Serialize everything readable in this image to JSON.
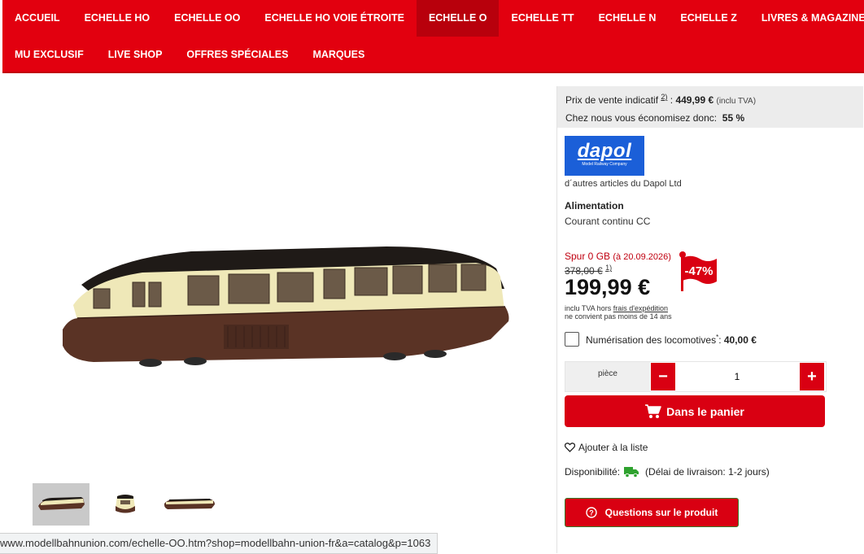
{
  "nav": {
    "row1": [
      "ACCUEIL",
      "ECHELLE HO",
      "ECHELLE OO",
      "ECHELLE HO VOIE ÉTROITE",
      "ECHELLE O",
      "ECHELLE TT",
      "ECHELLE N",
      "ECHELLE Z",
      "LIVRES & MAGAZINES"
    ],
    "row2": [
      "MU EXCLUSIF",
      "LIVE SHOP",
      "OFFRES SPÉCIALES",
      "MARQUES"
    ],
    "active": "ECHELLE O"
  },
  "price_info": {
    "rrp_label": "Prix de vente indicatif",
    "rrp_ref": "2)",
    "rrp_value": "449,99 €",
    "rrp_note": "(inclu TVA)",
    "saving_label": "Chez nous vous économisez donc:",
    "saving_value": "55 %"
  },
  "brand": {
    "logo_text": "dapol",
    "logo_subtext": "Model Railway Company",
    "more_link": "d´autres articles du Dapol Ltd"
  },
  "power": {
    "label": "Alimentation",
    "value": "Courant continu CC"
  },
  "offer": {
    "spur": "Spur 0 GB",
    "date": "(à 20.09.2026)",
    "old_price": "378,00 €",
    "old_price_ref": "1)",
    "price": "199,99 €",
    "discount": "-47%",
    "tax_prefix": "inclu TVA hors",
    "shipping_link": "frais d'expédition",
    "age_note": "ne convient pas moins de 14 ans"
  },
  "digitization": {
    "label": "Numérisation des locomotives",
    "ref": "*",
    "price": "40,00 €"
  },
  "quantity": {
    "unit": "pièce",
    "value": "1",
    "minus": "−",
    "plus": "+"
  },
  "cart_button": "Dans le panier",
  "wishlist": "Ajouter à la liste",
  "availability": {
    "label": "Disponibilité:",
    "value": "(Délai de livraison: 1-2 jours)"
  },
  "questions_button": "Questions sur le produit",
  "status_url": "www.modellbahnunion.com/echelle-OO.htm?shop=modellbahn-union-fr&a=catalog&p=1063",
  "colors": {
    "brand_red": "#e2000f",
    "button_red": "#d90012",
    "dapol_blue": "#1b5fd8",
    "truck_green": "#2fa22f",
    "train_brown": "#5a3325",
    "train_cream": "#f0ecc0"
  }
}
